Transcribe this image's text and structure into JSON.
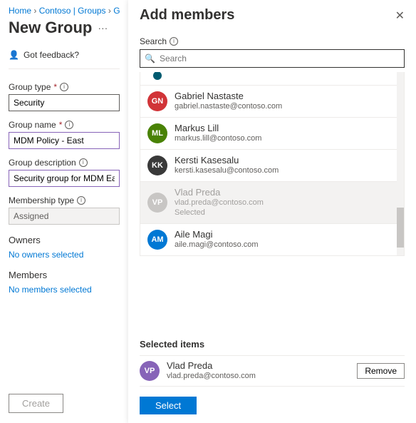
{
  "breadcrumb": {
    "home": "Home",
    "mid": "Contoso | Groups",
    "last": "G"
  },
  "page": {
    "title": "New Group",
    "more": "···"
  },
  "feedback": {
    "label": "Got feedback?"
  },
  "form": {
    "group_type": {
      "label": "Group type",
      "value": "Security"
    },
    "group_name": {
      "label": "Group name",
      "value": "MDM Policy - East"
    },
    "group_desc": {
      "label": "Group description",
      "value": "Security group for MDM East"
    },
    "membership": {
      "label": "Membership type",
      "value": "Assigned"
    },
    "owners_label": "Owners",
    "owners_link": "No owners selected",
    "members_label": "Members",
    "members_link": "No members selected",
    "create": "Create"
  },
  "panel": {
    "title": "Add members",
    "search_label": "Search",
    "search_placeholder": "Search",
    "selected_title": "Selected items",
    "selected_tag": "Selected",
    "remove": "Remove",
    "select": "Select"
  },
  "results": [
    {
      "initials": "",
      "name": "",
      "email": "",
      "color": "c-teal",
      "partial": true
    },
    {
      "initials": "GN",
      "name": "Gabriel Nastaste",
      "email": "gabriel.nastaste@contoso.com",
      "color": "c-red"
    },
    {
      "initials": "ML",
      "name": "Markus Lill",
      "email": "markus.lill@contoso.com",
      "color": "c-green"
    },
    {
      "initials": "KK",
      "name": "Kersti Kasesalu",
      "email": "kersti.kasesalu@contoso.com",
      "color": "c-black"
    },
    {
      "initials": "VP",
      "name": "Vlad Preda",
      "email": "vlad.preda@contoso.com",
      "color": "c-grey",
      "selected": true
    },
    {
      "initials": "AM",
      "name": "Aile Magi",
      "email": "aile.magi@contoso.com",
      "color": "c-blue"
    }
  ],
  "selected": [
    {
      "initials": "VP",
      "name": "Vlad Preda",
      "email": "vlad.preda@contoso.com",
      "color": "c-purple"
    }
  ]
}
